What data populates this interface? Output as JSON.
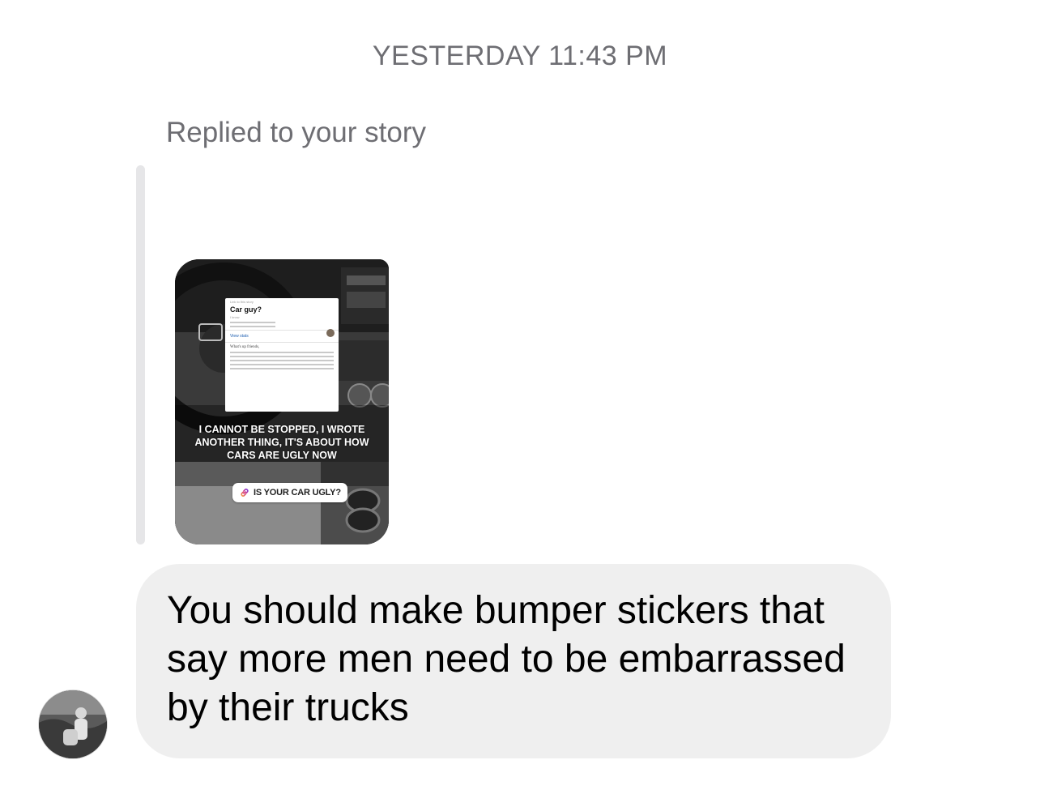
{
  "timestamp": "YESTERDAY 11:43 PM",
  "reply_context": "Replied to your story",
  "story": {
    "doc": {
      "kicker": "Link to this story",
      "title": "Car guy?",
      "subtitle": "I know",
      "link": "View stats",
      "greeting": "What's up friends,"
    },
    "overlay_text": "I CANNOT BE STOPPED, I WROTE ANOTHER THING, IT'S ABOUT HOW CARS ARE UGLY NOW",
    "link_sticker": {
      "icon": "link-icon",
      "label": "IS YOUR CAR UGLY?"
    }
  },
  "message": {
    "text": "You should make bumper stickers that say more men need to be embarrassed by their trucks"
  },
  "colors": {
    "bubble": "#efefef",
    "meta_text": "#6e6e73",
    "quote_bar": "#e6e6e8"
  }
}
